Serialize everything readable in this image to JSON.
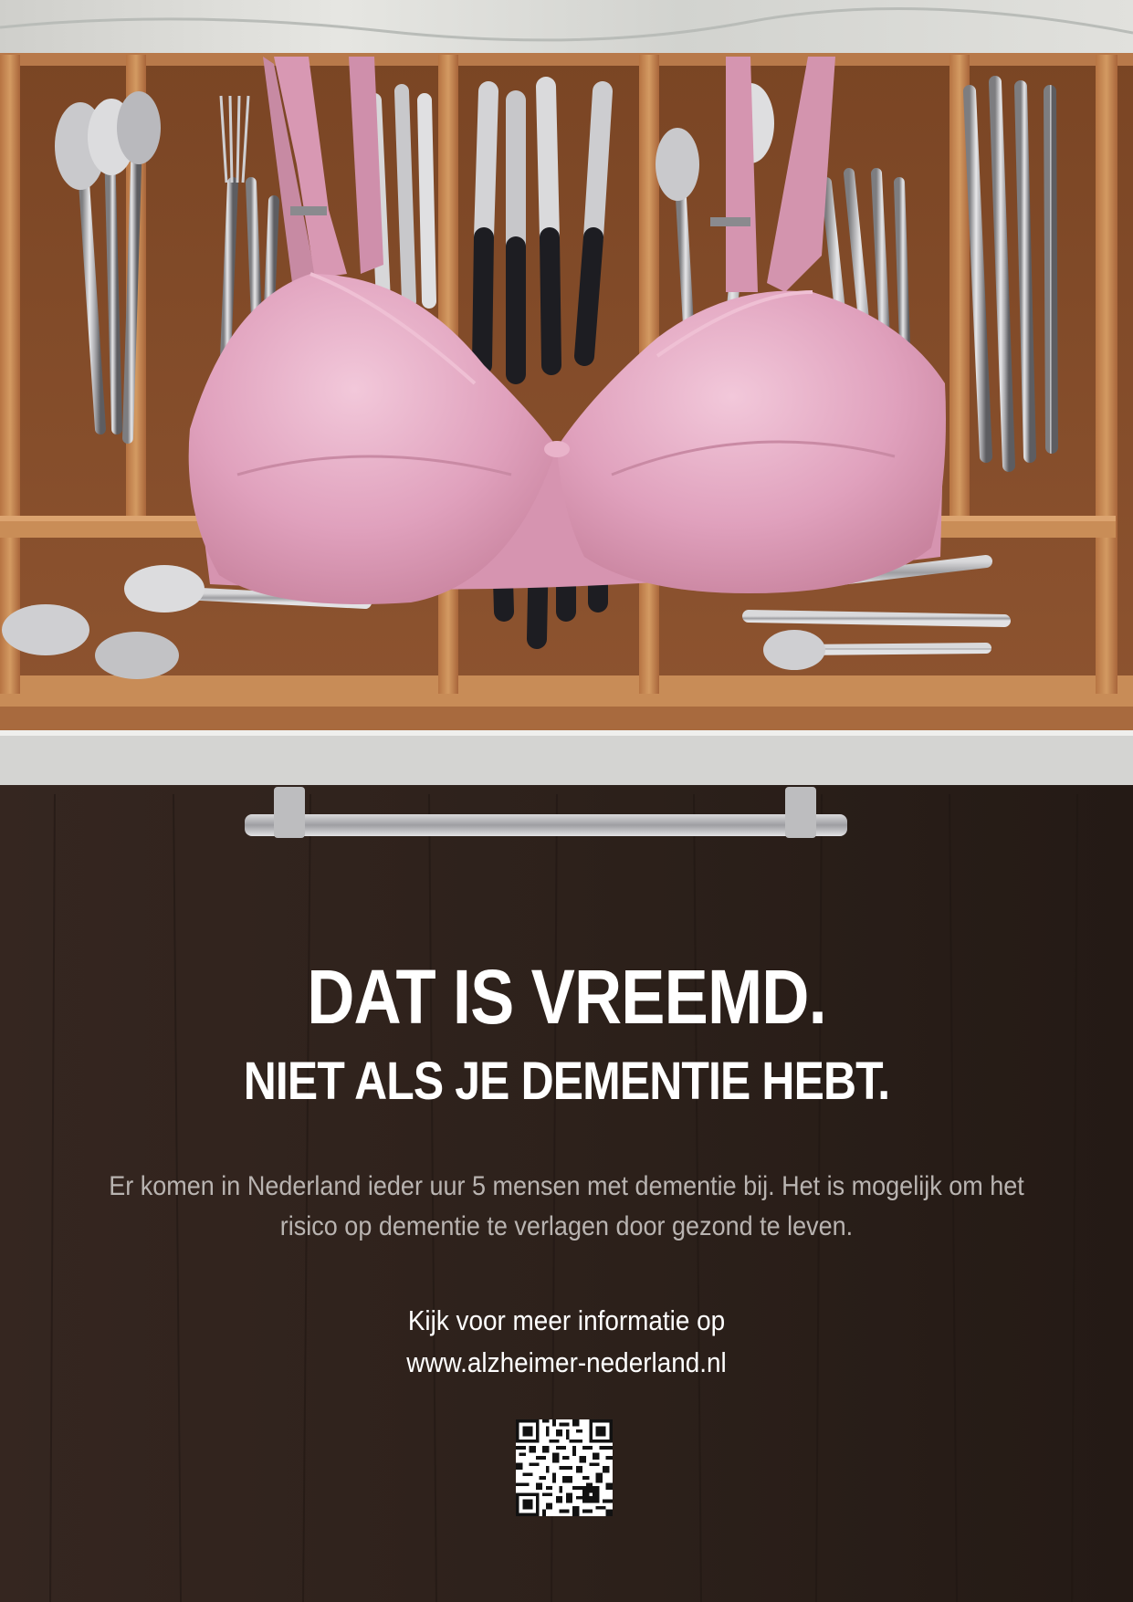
{
  "headline": "DAT IS VREEMD.",
  "subheadline": "NIET ALS JE DEMENTIE HEBT.",
  "body_lines": [
    "Er komen in Nederland ieder uur 5 mensen met dementie bij. Het is mogelijk om het",
    "risico op dementie te verlagen door gezond te leven."
  ],
  "cta_lines": [
    "Kijk voor meer informatie op",
    "www.alzheimer-nederland.nl"
  ],
  "colors": {
    "countertop": "#d9d8d4",
    "drawer_wood": "#9a5f36",
    "divider_wood": "#c4834f",
    "cabinet_front": "#2b201b",
    "bra_pink": "#e2a3bf",
    "text_primary": "#ffffff",
    "text_secondary": "#b9b4b1"
  },
  "icons": {
    "qr": "qr-code-icon"
  }
}
